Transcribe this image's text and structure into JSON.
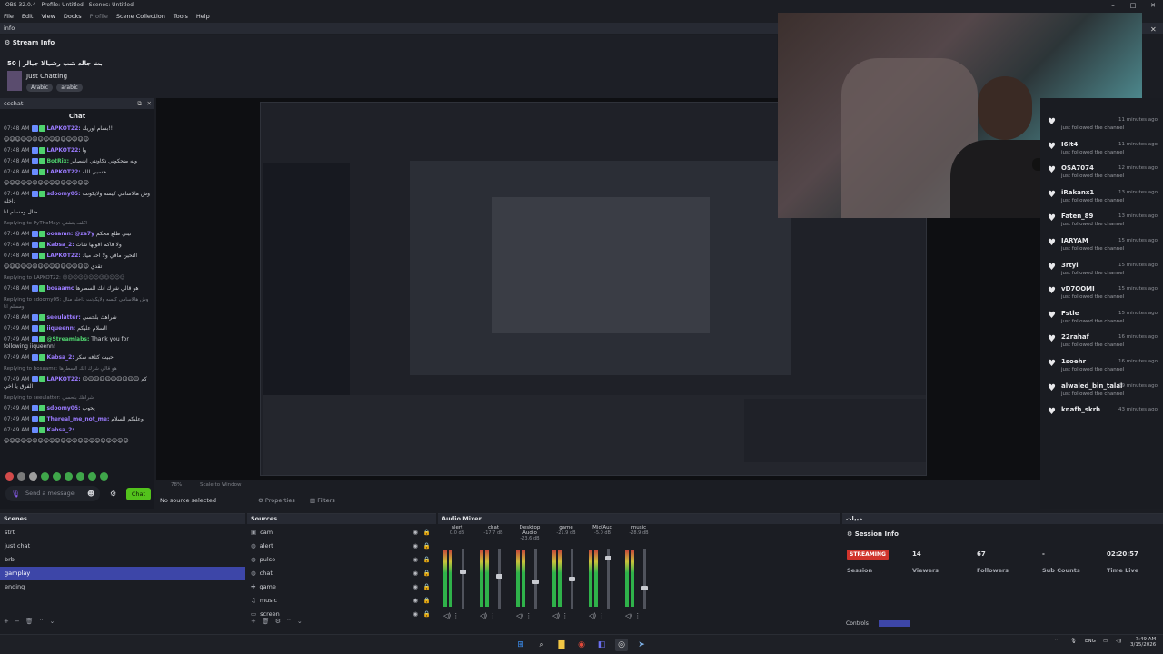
{
  "window": {
    "title": "OBS 32.0.4 - Profile: Untitled - Scenes: Untitled"
  },
  "menu": [
    "File",
    "Edit",
    "View",
    "Docks",
    "Profile",
    "Scene Collection",
    "Tools",
    "Help"
  ],
  "info_dock": {
    "label": "info"
  },
  "stream_info": {
    "header": "Stream Info",
    "title": "بث جالد شب رشيالا جيالر | 50",
    "category": "Just Chatting",
    "tags": [
      "Arabic",
      "arabic"
    ]
  },
  "chat_dock": {
    "label": "ccchat",
    "header": "Chat"
  },
  "chat_messages": [
    {
      "time": "07:48 AM",
      "user": "LAPKOT22:",
      "text": "بسام اوريك!!"
    },
    {
      "time": "",
      "user": "",
      "text": "☺☺☺☺☺☺☺☺☺☺☺☺☺☺☺"
    },
    {
      "time": "07:48 AM",
      "user": "LAPKOT22:",
      "text": "وا"
    },
    {
      "time": "07:48 AM",
      "user": "BotRix:",
      "text": "وله ضحكوني ذكاونتي اشصاير"
    },
    {
      "time": "07:48 AM",
      "user": "LAPKOT22:",
      "text": "حسبي الله"
    },
    {
      "time": "",
      "user": "",
      "text": "☺☺☺☺☺☺☺☺☺☺☺☺☺☺☺"
    },
    {
      "time": "07:48 AM",
      "user": "sdoomy05:",
      "text": "وش هالاسامي كيسه ولايكونت داخله"
    },
    {
      "time": "",
      "user": "",
      "text": "منال ومسلم انا"
    },
    {
      "time": "",
      "user": "",
      "text": "Replying to PyThoMay: اكلف بتشتي"
    },
    {
      "time": "07:48 AM",
      "user": "oosamn: @za7y",
      "text": "تيتي طلع محكم"
    },
    {
      "time": "07:48 AM",
      "user": "Kabsa_2:",
      "text": "ولا قاكم اقولها شات"
    },
    {
      "time": "07:48 AM",
      "user": "LAPKOT22:",
      "text": "التحين مافي ولا احد مياد"
    },
    {
      "time": "",
      "user": "",
      "text": "☺☺☺☺☺☺☺☺☺☺☺☺☺☺☺ تقدي"
    },
    {
      "time": "",
      "user": "",
      "text": "Replying to LAPKOT22: ☺☺☺☺☺☺☺☺☺☺☺☺"
    },
    {
      "time": "07:48 AM",
      "user": "bosaamc",
      "text": "هو قالي شرك انك السطرها"
    },
    {
      "time": "",
      "user": "",
      "text": "Replying to sdoomy05: وش هالاسامي كيسه ولايكونت داخله منال ومسلم انا"
    },
    {
      "time": "07:48 AM",
      "user": "seeulatter:",
      "text": "شراهك بلحسي"
    },
    {
      "time": "07:49 AM",
      "user": "iiqueenn:",
      "text": "السلام عليكم"
    },
    {
      "time": "07:49 AM",
      "user": "@Streamlabs:",
      "text": "Thank you for following iiqueenn!"
    },
    {
      "time": "07:49 AM",
      "user": "Kabsa_2:",
      "text": "حبيت كثافه سكر"
    },
    {
      "time": "",
      "user": "",
      "text": "Replying to bosaamc: هو قالي شرك انك السطرها"
    },
    {
      "time": "07:49 AM",
      "user": "LAPKOT22:",
      "text": "☺☺☺☺☺☺☺☺☺☺ كم الفرق يا اخي"
    },
    {
      "time": "",
      "user": "",
      "text": "Replying to seeulatter: شراهك بلحسي"
    },
    {
      "time": "07:49 AM",
      "user": "sdoomy05:",
      "text": "يحوب"
    },
    {
      "time": "07:49 AM",
      "user": "Thereal_me_not_me:",
      "text": "وعليكم السلام"
    },
    {
      "time": "07:49 AM",
      "user": "Kabsa_2:",
      "text": ""
    },
    {
      "time": "",
      "user": "",
      "text": "☺☺☺☺☺☺☺☺☺☺☺☺☺☺☺☺☺☺☺☺☺☺"
    }
  ],
  "chat_input": {
    "placeholder": "Send a message",
    "send_label": "Chat"
  },
  "preview_status": {
    "no_source": "No source selected",
    "properties": "Properties",
    "filters": "Filters"
  },
  "followers": [
    {
      "name": "",
      "sub": "just followed the channel",
      "time": "11 minutes ago"
    },
    {
      "name": "I6It4",
      "sub": "just followed the channel",
      "time": "11 minutes ago"
    },
    {
      "name": "OSA7074",
      "sub": "just followed the channel",
      "time": "12 minutes ago"
    },
    {
      "name": "iRakanx1",
      "sub": "just followed the channel",
      "time": "13 minutes ago"
    },
    {
      "name": "Faten_89",
      "sub": "just followed the channel",
      "time": "13 minutes ago"
    },
    {
      "name": "IARYAM",
      "sub": "just followed the channel",
      "time": "15 minutes ago"
    },
    {
      "name": "3rtyi",
      "sub": "just followed the channel",
      "time": "15 minutes ago"
    },
    {
      "name": "vD7OOMI",
      "sub": "just followed the channel",
      "time": "15 minutes ago"
    },
    {
      "name": "Fstle",
      "sub": "just followed the channel",
      "time": "15 minutes ago"
    },
    {
      "name": "22rahaf",
      "sub": "just followed the channel",
      "time": "16 minutes ago"
    },
    {
      "name": "1soehr",
      "sub": "just followed the channel",
      "time": "16 minutes ago"
    },
    {
      "name": "alwaled_bin_talal",
      "sub": "just followed the channel",
      "time": "39 minutes ago"
    },
    {
      "name": "knafh_skrh",
      "sub": "",
      "time": "43 minutes ago"
    }
  ],
  "scenes": {
    "title": "Scenes",
    "items": [
      "strt",
      "just chat",
      "brb",
      "gamplay",
      "ending"
    ],
    "selected": 3
  },
  "sources": {
    "title": "Sources",
    "items": [
      {
        "name": "cam",
        "icon": "camera-icon"
      },
      {
        "name": "alert",
        "icon": "globe-icon"
      },
      {
        "name": "pulse",
        "icon": "globe-icon"
      },
      {
        "name": "chat",
        "icon": "globe-icon"
      },
      {
        "name": "game",
        "icon": "gamepad-icon"
      },
      {
        "name": "music",
        "icon": "music-icon"
      },
      {
        "name": "screen",
        "icon": "monitor-icon"
      }
    ]
  },
  "mixer": {
    "title": "Audio Mixer",
    "channels": [
      {
        "name": "alert",
        "db": "0.0 dB",
        "level": 0.62
      },
      {
        "name": "chat",
        "db": "-17.7 dB",
        "level": 0.55
      },
      {
        "name": "Desktop Audio",
        "db": "-23.6 dB",
        "level": 0.45
      },
      {
        "name": "game",
        "db": "-21.9 dB",
        "level": 0.5
      },
      {
        "name": "Mic/Aux",
        "db": "-5.0 dB",
        "level": 0.85
      },
      {
        "name": "music",
        "db": "-28.9 dB",
        "level": 0.35
      }
    ]
  },
  "session": {
    "dock_label": "مبيات",
    "header": "Session Info",
    "status": "STREAMING",
    "stats": [
      {
        "value": "14",
        "label": "Viewers"
      },
      {
        "value": "67",
        "label": "Followers"
      },
      {
        "value": "-",
        "label": "Sub Counts"
      },
      {
        "value": "02:20:57",
        "label": "Time Live"
      }
    ],
    "session_label": "Session",
    "controls_tab": "Controls"
  },
  "preview_bar": {
    "zoom": "78%",
    "scale": "Scale to Window"
  },
  "tray": {
    "lang": "ENG",
    "time": "7:49 AM",
    "date": "3/15/2026"
  },
  "colors": {
    "accent": "#3d46a8",
    "chat_button": "#53c21c",
    "streaming": "#d0342c"
  }
}
